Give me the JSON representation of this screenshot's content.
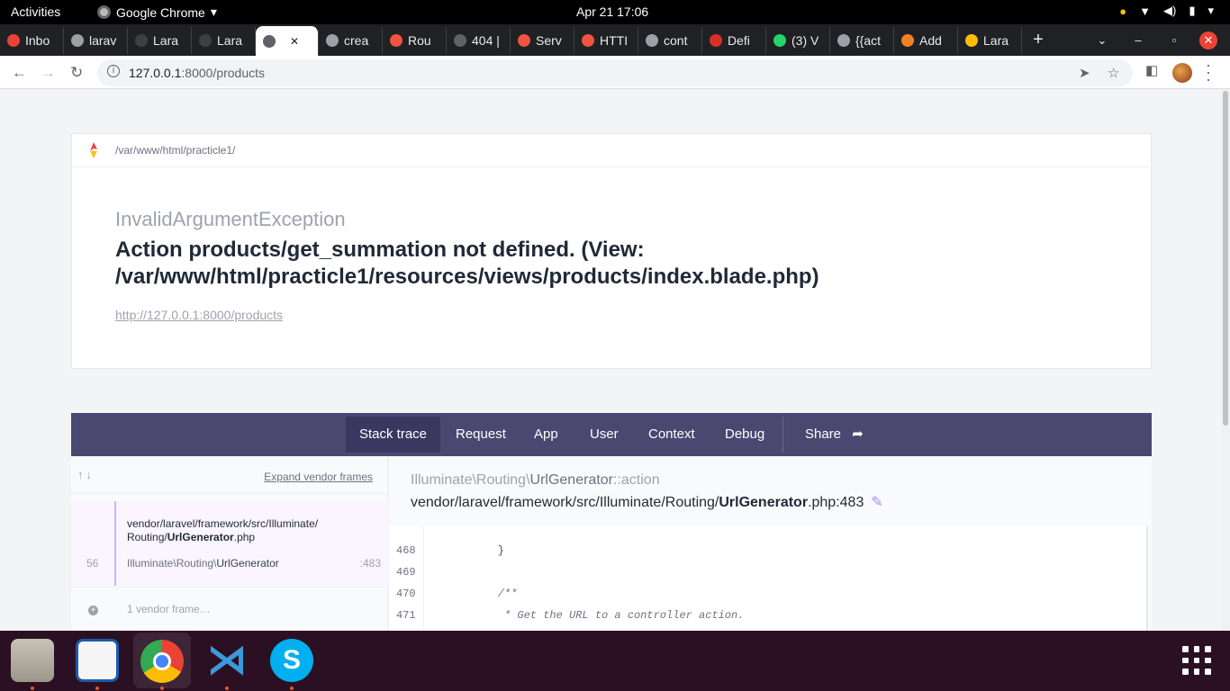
{
  "topbar": {
    "activities": "Activities",
    "app_name": "Google Chrome",
    "clock": "Apr 21  17:06"
  },
  "tabs": [
    {
      "label": "Inbo",
      "favicon_color": "#ea4335"
    },
    {
      "label": "larav",
      "favicon_color": "#9aa0a6"
    },
    {
      "label": "Lara",
      "favicon_color": "#3c4043"
    },
    {
      "label": "Lara",
      "favicon_color": "#3c4043"
    },
    {
      "label": "",
      "favicon_color": "#5f6368",
      "active": true
    },
    {
      "label": "crea",
      "favicon_color": "#9aa0a6"
    },
    {
      "label": "Rou",
      "favicon_color": "#f05340"
    },
    {
      "label": "404 |",
      "favicon_color": "#5f6368"
    },
    {
      "label": "Serv",
      "favicon_color": "#f05340"
    },
    {
      "label": "HTTI",
      "favicon_color": "#f05340"
    },
    {
      "label": "cont",
      "favicon_color": "#9aa0a6"
    },
    {
      "label": "Defi",
      "favicon_color": "#d93025"
    },
    {
      "label": "(3) V",
      "favicon_color": "#25d366"
    },
    {
      "label": "{{act",
      "favicon_color": "#9aa0a6"
    },
    {
      "label": "Add",
      "favicon_color": "#f48024"
    },
    {
      "label": "Lara",
      "favicon_color": "#fbbc04"
    }
  ],
  "address": {
    "host": "127.0.0.1",
    "rest": ":8000/products"
  },
  "error": {
    "path": "/var/www/html/practicle1/",
    "exception": "InvalidArgumentException",
    "message": "Action products/get_summation not defined. (View: /var/www/html/practicle1/resources/views/products/index.blade.php)",
    "url": "http://127.0.0.1:8000/products"
  },
  "panel_tabs": [
    "Stack trace",
    "Request",
    "App",
    "User",
    "Context",
    "Debug"
  ],
  "share_label": "Share",
  "stack": {
    "expand_label": "Expand vendor frames",
    "frame_file_line1": "vendor/laravel/framework/src/Illuminate/",
    "frame_file_dir": "Routing/",
    "frame_file_name": "UrlGenerator",
    "frame_file_ext": ".php",
    "frame_number": "56",
    "frame_class_ns": "Illuminate\\Routing\\",
    "frame_class_name": "UrlGenerator",
    "frame_line": ":483",
    "vendor_frames": "1 vendor frame…",
    "detail_ns": "Illuminate\\Routing\\",
    "detail_class": "UrlGenerator",
    "detail_method": "::action",
    "detail_path": "vendor/laravel/framework/src/Illuminate/Routing/",
    "detail_file": "UrlGenerator",
    "detail_ext": ".php:483"
  },
  "code_lines": [
    {
      "n": "468",
      "c": "    }",
      "plain": true
    },
    {
      "n": "469",
      "c": "",
      "plain": true
    },
    {
      "n": "470",
      "c": "    /**",
      "plain": false
    },
    {
      "n": "471",
      "c": "     * Get the URL to a controller action.",
      "plain": false
    }
  ]
}
